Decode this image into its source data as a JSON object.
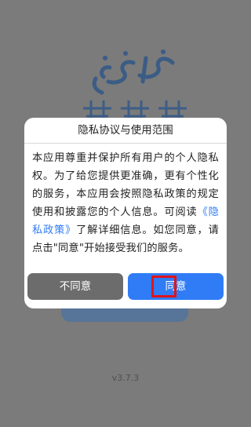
{
  "app": {
    "version": "v3.7.3"
  },
  "dialog": {
    "title": "隐私协议与使用范围",
    "body_before": "本应用尊重并保护所有用户的个人隐私权。为了给您提供更准确，更有个性化的服务，本应用会按照隐私政策的规定使用和披露您的个人信息。可阅读",
    "policy_link": "《隐私政策》",
    "body_after": "了解详细信息。如您同意，请点击\"同意\"开始接受我们的服务。",
    "disagree_label": "不同意",
    "agree_label": "同意"
  },
  "colors": {
    "background": "#7b7b7b",
    "link": "#2f7cf6",
    "agree_button": "#2f7cf6",
    "disagree_button": "#6c6c6c",
    "highlight": "#e0141c"
  }
}
